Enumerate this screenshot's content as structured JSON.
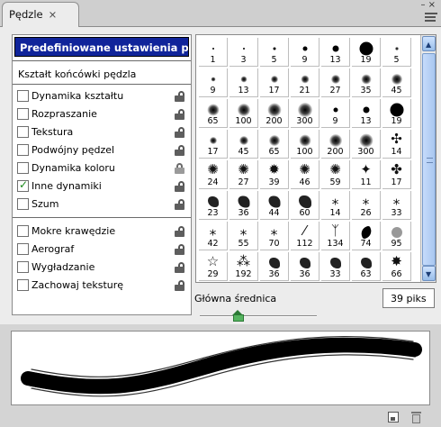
{
  "tab": {
    "title": "Pędzle",
    "close": "×"
  },
  "left_panel": {
    "preset_title": "Predefiniowane ustawienia pędzla",
    "tip_shape": "Kształt końcówki pędzla",
    "options": [
      {
        "label": "Dynamika kształtu",
        "checked": false,
        "lock": "unlocked"
      },
      {
        "label": "Rozpraszanie",
        "checked": false,
        "lock": "unlocked"
      },
      {
        "label": "Tekstura",
        "checked": false,
        "lock": "unlocked"
      },
      {
        "label": "Podwójny pędzel",
        "checked": false,
        "lock": "unlocked"
      },
      {
        "label": "Dynamika koloru",
        "checked": false,
        "lock": "locked"
      },
      {
        "label": "Inne dynamiki",
        "checked": true,
        "lock": "unlocked"
      },
      {
        "label": "Szum",
        "checked": false,
        "lock": "unlocked"
      },
      {
        "label": "Mokre krawędzie",
        "checked": false,
        "lock": "unlocked"
      },
      {
        "label": "Aerograf",
        "checked": false,
        "lock": "unlocked"
      },
      {
        "label": "Wygładzanie",
        "checked": false,
        "lock": "unlocked"
      },
      {
        "label": "Zachowaj teksturę",
        "checked": false,
        "lock": "unlocked"
      }
    ]
  },
  "brush_grid": {
    "rows": [
      [
        {
          "num": "1",
          "kind": "hard",
          "s": 2
        },
        {
          "num": "3",
          "kind": "hard",
          "s": 2
        },
        {
          "num": "5",
          "kind": "hard",
          "s": 3
        },
        {
          "num": "9",
          "kind": "hard",
          "s": 5
        },
        {
          "num": "13",
          "kind": "hard",
          "s": 7
        },
        {
          "num": "19",
          "kind": "hard",
          "s": 15
        },
        {
          "num": "5",
          "kind": "soft",
          "s": 4
        }
      ],
      [
        {
          "num": "9",
          "kind": "soft",
          "s": 5
        },
        {
          "num": "13",
          "kind": "soft",
          "s": 7
        },
        {
          "num": "17",
          "kind": "soft",
          "s": 8
        },
        {
          "num": "21",
          "kind": "soft",
          "s": 9
        },
        {
          "num": "27",
          "kind": "soft",
          "s": 10
        },
        {
          "num": "35",
          "kind": "soft",
          "s": 11
        },
        {
          "num": "45",
          "kind": "soft",
          "s": 12
        }
      ],
      [
        {
          "num": "65",
          "kind": "soft",
          "s": 13
        },
        {
          "num": "100",
          "kind": "soft",
          "s": 14
        },
        {
          "num": "200",
          "kind": "soft",
          "s": 15
        },
        {
          "num": "300",
          "kind": "soft",
          "s": 16
        },
        {
          "num": "9",
          "kind": "hard",
          "s": 5
        },
        {
          "num": "13",
          "kind": "hard",
          "s": 7
        },
        {
          "num": "19",
          "kind": "hard",
          "s": 15
        }
      ],
      [
        {
          "num": "17",
          "kind": "soft",
          "s": 8
        },
        {
          "num": "45",
          "kind": "soft",
          "s": 10
        },
        {
          "num": "65",
          "kind": "soft",
          "s": 12
        },
        {
          "num": "100",
          "kind": "soft",
          "s": 13
        },
        {
          "num": "200",
          "kind": "soft",
          "s": 14
        },
        {
          "num": "300",
          "kind": "soft",
          "s": 15
        },
        {
          "num": "14",
          "kind": "glyph",
          "g": "✣"
        }
      ],
      [
        {
          "num": "24",
          "kind": "glyph",
          "g": "✺"
        },
        {
          "num": "27",
          "kind": "glyph",
          "g": "✺"
        },
        {
          "num": "39",
          "kind": "glyph",
          "g": "✹"
        },
        {
          "num": "46",
          "kind": "glyph",
          "g": "✺"
        },
        {
          "num": "59",
          "kind": "glyph",
          "g": "✺"
        },
        {
          "num": "11",
          "kind": "glyph",
          "g": "✦"
        },
        {
          "num": "17",
          "kind": "glyph",
          "g": "✤"
        }
      ],
      [
        {
          "num": "23",
          "kind": "splat",
          "s": 12
        },
        {
          "num": "36",
          "kind": "splat",
          "s": 13
        },
        {
          "num": "44",
          "kind": "splat",
          "s": 13
        },
        {
          "num": "60",
          "kind": "splat",
          "s": 14
        },
        {
          "num": "14",
          "kind": "glyph",
          "g": "⁎"
        },
        {
          "num": "26",
          "kind": "glyph",
          "g": "⁎"
        },
        {
          "num": "33",
          "kind": "glyph",
          "g": "⁎"
        }
      ],
      [
        {
          "num": "42",
          "kind": "glyph",
          "g": "⁎"
        },
        {
          "num": "55",
          "kind": "glyph",
          "g": "⁎"
        },
        {
          "num": "70",
          "kind": "glyph",
          "g": "⁎"
        },
        {
          "num": "112",
          "kind": "glyph",
          "g": "⁄"
        },
        {
          "num": "134",
          "kind": "glyph",
          "g": "ᛉ"
        },
        {
          "num": "74",
          "kind": "leaf",
          "s": 12
        },
        {
          "num": "95",
          "kind": "gray",
          "s": 12
        }
      ],
      [
        {
          "num": "29",
          "kind": "glyph",
          "g": "☆"
        },
        {
          "num": "192",
          "kind": "glyph",
          "g": "⁂"
        },
        {
          "num": "36",
          "kind": "splat",
          "s": 12
        },
        {
          "num": "36",
          "kind": "splat",
          "s": 12
        },
        {
          "num": "33",
          "kind": "splat",
          "s": 12
        },
        {
          "num": "63",
          "kind": "splat",
          "s": 12
        },
        {
          "num": "66",
          "kind": "glyph",
          "g": "✸"
        }
      ],
      [
        {
          "num": "",
          "kind": "splat",
          "s": 10
        },
        {
          "num": "",
          "kind": "splat",
          "s": 10
        },
        {
          "num": "",
          "kind": "splat",
          "s": 10
        },
        {
          "num": "",
          "kind": "splat",
          "s": 10
        },
        {
          "num": "",
          "kind": "splat",
          "s": 10
        },
        {
          "num": "",
          "kind": "hard",
          "s": 12
        },
        {
          "num": "",
          "kind": "soft",
          "s": 10
        }
      ]
    ]
  },
  "diameter": {
    "label": "Główna średnica",
    "value": "39 piks",
    "slider_fraction": 0.32
  },
  "icons": {
    "new_preset": "new-brush-preset-icon",
    "delete": "trash-icon"
  },
  "colors": {
    "preset_bar_bg": "#10249a",
    "scrollbar_blue": "#a9c7f0",
    "slider_green": "#55b35f"
  }
}
